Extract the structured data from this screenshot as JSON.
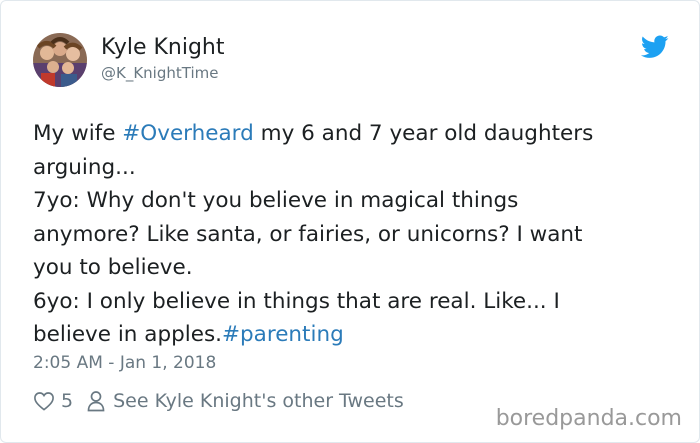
{
  "author": {
    "name": "Kyle Knight",
    "handle": "@K_KnightTime",
    "avatar_icon": "avatar-photo"
  },
  "platform_icon": "twitter-bird-icon",
  "tweet": {
    "line1_pre": "My wife ",
    "line1_hashtag": "#Overheard",
    "line1_post": " my 6 and 7 year old daughters",
    "line2": "arguing...",
    "line3": "7yo: Why don't you believe in magical things",
    "line4": "anymore? Like santa, or fairies, or unicorns? I want",
    "line5": "you to believe.",
    "line6": "6yo: I only believe in things that are real. Like... I",
    "line7_pre": "believe in apples.",
    "line7_hashtag": "#parenting"
  },
  "timestamp": "2:05 AM - Jan 1, 2018",
  "actions": {
    "like_count": "5",
    "see_other": "See Kyle Knight's other Tweets"
  },
  "watermark": "boredpanda.com",
  "colors": {
    "hashtag": "#2b7bb9",
    "twitter_blue": "#1da1f2",
    "muted": "#697882",
    "text": "#1c2022"
  }
}
